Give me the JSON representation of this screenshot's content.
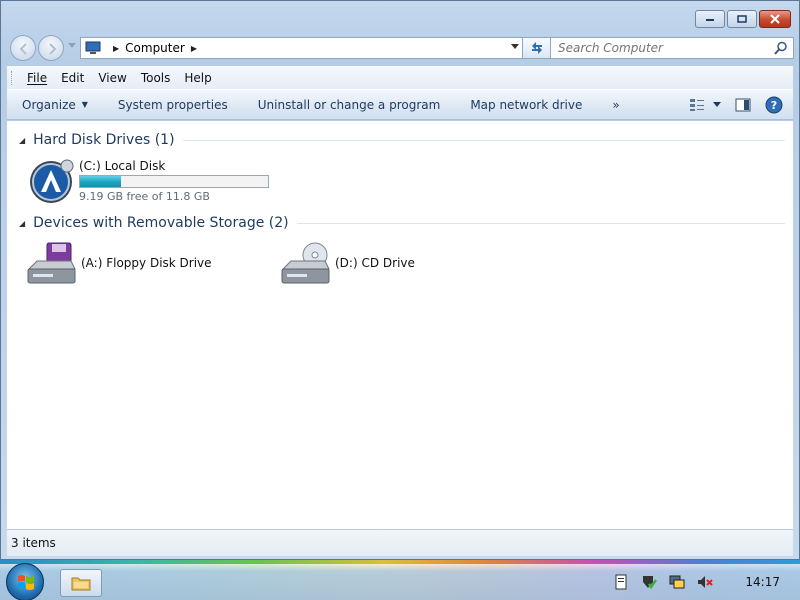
{
  "window": {
    "caption": {
      "minimize_icon": "minimize-icon",
      "restore_icon": "restore-icon",
      "close_icon": "close-icon"
    }
  },
  "address_bar": {
    "icon": "computer-icon",
    "breadcrumb": [
      "Computer"
    ]
  },
  "search": {
    "placeholder": "Search Computer",
    "icon": "search-icon"
  },
  "menu": {
    "items": [
      "File",
      "Edit",
      "View",
      "Tools",
      "Help"
    ]
  },
  "command_bar": {
    "organize": "Organize",
    "system_properties": "System properties",
    "uninstall": "Uninstall or change a program",
    "map_drive": "Map network drive",
    "more": "»"
  },
  "groups": {
    "hard_disk": {
      "title": "Hard Disk Drives (1)",
      "drives": [
        {
          "name": "(C:) Local Disk",
          "space_text": "9.19 GB free of 11.8 GB",
          "used_fraction": 0.22,
          "icon": "hard-disk-icon"
        }
      ]
    },
    "removable": {
      "title": "Devices with Removable Storage (2)",
      "drives": [
        {
          "name": "(A:) Floppy Disk Drive",
          "icon": "floppy-drive-icon"
        },
        {
          "name": "(D:) CD Drive",
          "icon": "cd-drive-icon"
        }
      ]
    }
  },
  "status": {
    "items": "3 items"
  },
  "taskbar": {
    "start_icon": "windows-start-icon",
    "explorer_icon": "explorer-folder-icon",
    "clock": "14:17"
  },
  "colors": {
    "accent": "#1aa4c3",
    "close": "#c74a2f"
  }
}
